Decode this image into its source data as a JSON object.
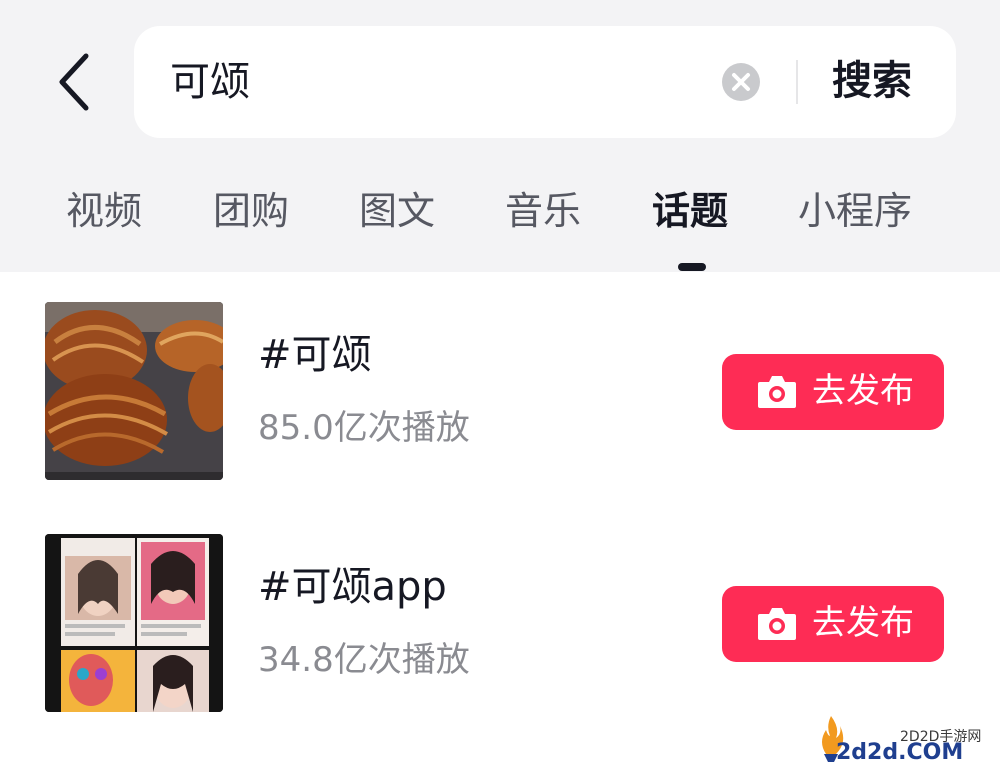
{
  "search": {
    "query": "可颂",
    "button_label": "搜索"
  },
  "tabs": [
    {
      "label": "视频",
      "active": false
    },
    {
      "label": "团购",
      "active": false
    },
    {
      "label": "图文",
      "active": false
    },
    {
      "label": "音乐",
      "active": false
    },
    {
      "label": "话题",
      "active": true
    },
    {
      "label": "小程序",
      "active": false
    }
  ],
  "results": [
    {
      "title": "#可颂",
      "plays": "85.0亿次播放",
      "action_label": "去发布",
      "thumbnail": "croissant-photo"
    },
    {
      "title": "#可颂app",
      "plays": "34.8亿次播放",
      "action_label": "去发布",
      "thumbnail": "makeup-collage"
    }
  ],
  "watermark": {
    "top": "2D2D手游网",
    "main": "2d2d.COM"
  },
  "colors": {
    "accent": "#fe2c55",
    "background": "#f3f3f5",
    "text": "#161823",
    "muted": "#8a8b91"
  },
  "icons": [
    "back-arrow-icon",
    "clear-icon",
    "camera-icon"
  ]
}
